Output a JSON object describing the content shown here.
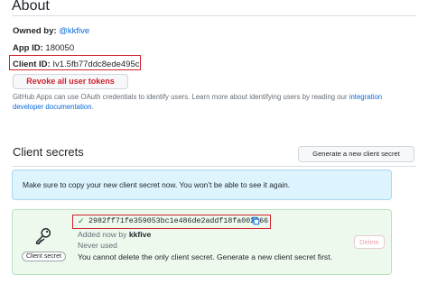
{
  "about": {
    "title": "About",
    "owned_by_label": "Owned by:",
    "owned_by_value": "@kkfive",
    "app_id_label": "App ID:",
    "app_id_value": "180050",
    "client_id_label": "Client ID:",
    "client_id_value": "Iv1.5fb77ddc8ede495c",
    "revoke_label": "Revoke all user tokens",
    "help_text": "GitHub Apps can use OAuth credentials to identify users. Learn more about identifying users by reading our ",
    "help_link": "integration developer documentation",
    "help_end": "."
  },
  "client_secrets": {
    "title": "Client secrets",
    "generate_label": "Generate a new client secret",
    "flash_text": "Make sure to copy your new client secret now. You won’t be able to see it again.",
    "secret": {
      "key_label": "Client secret",
      "value": "2982ff71fe359053bc1e486de2addf18fa002066",
      "added_by_prefix": "Added now by",
      "added_by_user": "kkfive",
      "usage": "Never used",
      "note": "You cannot delete the only client secret. Generate a new client secret first.",
      "delete_label": "Delete"
    }
  },
  "icons": {
    "check": "check-icon",
    "copy": "copy-icon",
    "key": "key-icon"
  },
  "colors": {
    "link": "#0969da",
    "danger": "#cf222e",
    "success": "#1a7f37",
    "flash_bg": "#ddf4ff",
    "secret_bg": "#eef9ee"
  }
}
